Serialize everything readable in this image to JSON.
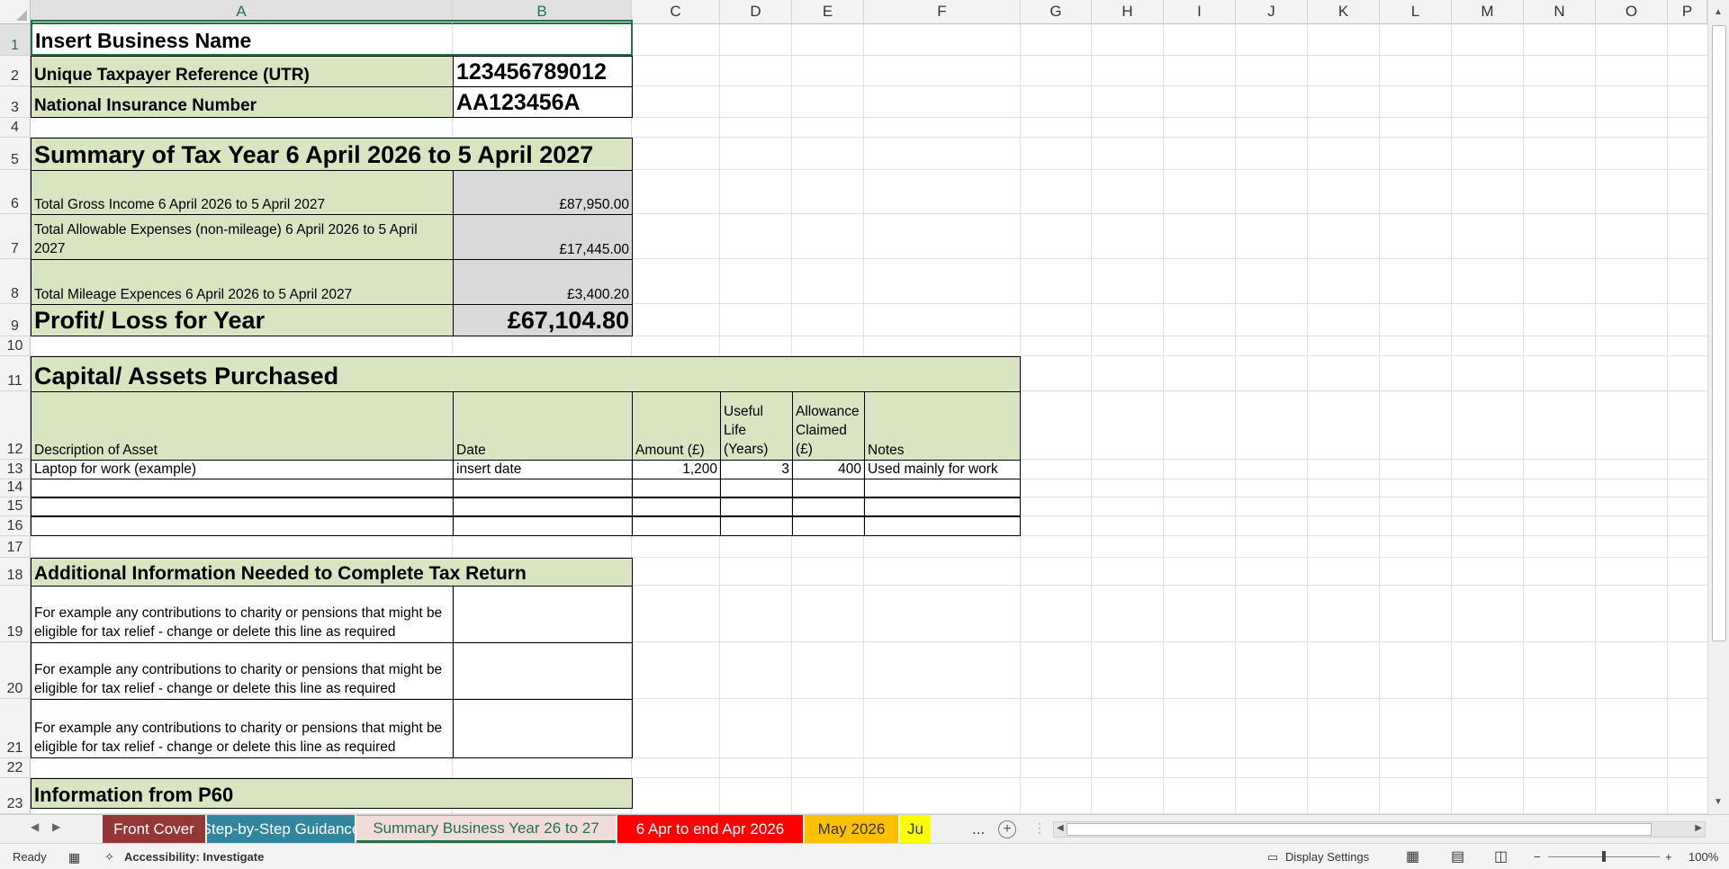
{
  "columns": [
    "A",
    "B",
    "C",
    "D",
    "E",
    "F",
    "G",
    "H",
    "I",
    "J",
    "K",
    "L",
    "M",
    "N",
    "O",
    "P"
  ],
  "rows": [
    "1",
    "2",
    "3",
    "4",
    "5",
    "6",
    "7",
    "8",
    "9",
    "10",
    "11",
    "12",
    "13",
    "14",
    "15",
    "16",
    "17",
    "18",
    "19",
    "20",
    "21",
    "22",
    "23"
  ],
  "business_name": "Insert Business Name",
  "utr_label": "Unique Taxpayer Reference (UTR)",
  "utr_value": "123456789012",
  "nin_label": "National Insurance Number",
  "nin_value": "AA123456A",
  "summary_title": "Summary of Tax Year 6 April 2026 to 5 April 2027",
  "gross_income_label": "Total Gross Income 6 April 2026 to 5 April 2027",
  "gross_income_value": "£87,950.00",
  "allowable_label": "Total Allowable Expenses (non-mileage) 6 April 2026 to 5 April 2027",
  "allowable_value": "£17,445.00",
  "mileage_label": "Total Mileage Expences 6 April 2026 to 5 April 2027",
  "mileage_value": "£3,400.20",
  "profit_label": "Profit/ Loss for Year",
  "profit_value": "£67,104.80",
  "capital": {
    "title": "Capital/ Assets Purchased",
    "headers": [
      "Description of Asset",
      "Date",
      "Amount (£)",
      "Useful Life (Years)",
      "Allowance Claimed (£)",
      "Notes"
    ],
    "rows": [
      [
        "Laptop for work (example)",
        "insert date",
        "1,200",
        "3",
        "400",
        "Used mainly for work"
      ]
    ]
  },
  "additional": {
    "title": "Additional Information Needed to Complete Tax Return",
    "lines": [
      "For example any contributions to charity or pensions that might be eligible for tax relief - change or delete this line as required",
      "For example any contributions to charity or pensions that might be eligible for tax relief - change or delete this line as required",
      "For example any contributions to charity or pensions that might be eligible for tax relief - change or delete this line as required"
    ]
  },
  "p60_title": "Information from P60",
  "tabs": [
    {
      "label": "Front Cover",
      "color": "#953735"
    },
    {
      "label": "Step-by-Step Guidance",
      "color": "#31859c"
    },
    {
      "label": "Summary Business Year 26 to 27",
      "color": "#d99694",
      "active": true
    },
    {
      "label": "6 Apr to end Apr 2026",
      "color": "#ff0000"
    },
    {
      "label": "May 2026",
      "color": "#ffc000"
    },
    {
      "label": "Ju",
      "color": "#ffff00"
    }
  ],
  "tab_overflow": "...",
  "status": {
    "ready": "Ready",
    "accessibility": "Accessibility: Investigate",
    "display_settings": "Display Settings",
    "zoom": "100%"
  }
}
